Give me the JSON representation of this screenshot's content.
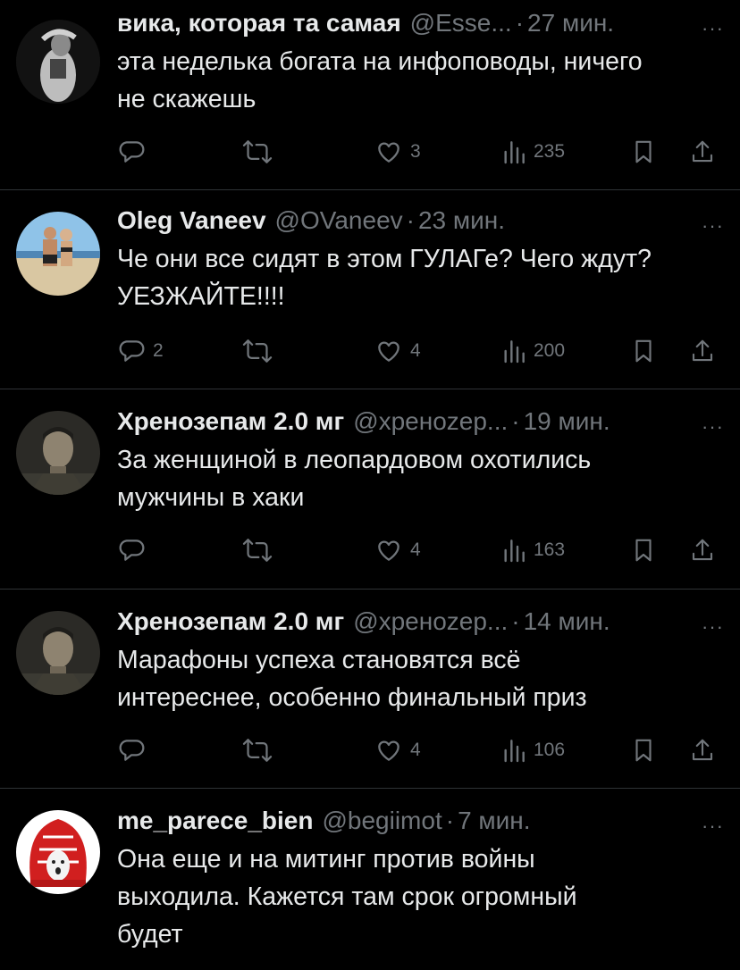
{
  "tweets": [
    {
      "name": "вика, которая та самая",
      "handle": "@Esse...",
      "time": "27 мин.",
      "text_lines": [
        "эта неделька богата на инфоповоды, ничего",
        "не скажешь"
      ],
      "replies": "",
      "likes": "3",
      "views": "235"
    },
    {
      "name": "Oleg Vaneev",
      "handle": "@OVaneev",
      "time": "23 мин.",
      "text_lines": [
        "Че они все сидят в этом ГУЛАГе? Чего ждут?",
        "УЕЗЖАЙТЕ!!!!"
      ],
      "replies": "2",
      "likes": "4",
      "views": "200"
    },
    {
      "name": "Хренозепам 2.0 мг",
      "handle": "@хренozep...",
      "time": "19 мин.",
      "text_lines": [
        "За женщиной в леопардовом охотились",
        "мужчины в хаки"
      ],
      "replies": "",
      "likes": "4",
      "views": "163"
    },
    {
      "name": "Хренозепам 2.0 мг",
      "handle": "@хренozep...",
      "time": "14 мин.",
      "text_lines": [
        "Марафоны успеха становятся всё",
        "интереснее, особенно финальный приз"
      ],
      "replies": "",
      "likes": "4",
      "views": "106"
    },
    {
      "name": "me_parece_bien",
      "handle": "@begiimot",
      "time": "7 мин.",
      "text_lines": [
        "Она еще и на митинг против войны",
        "выходила. Кажется там срок огромный",
        "будет"
      ],
      "replies": "",
      "likes": "",
      "views": ""
    }
  ],
  "ui": {
    "separator": "·",
    "more": "···"
  },
  "icons": [
    "reply-icon",
    "retweet-icon",
    "like-icon",
    "views-icon",
    "bookmark-icon",
    "share-icon",
    "more-icon"
  ],
  "colors": {
    "background": "#000000",
    "text": "#e7e9ea",
    "muted": "#71767b",
    "divider": "#2f3336"
  }
}
